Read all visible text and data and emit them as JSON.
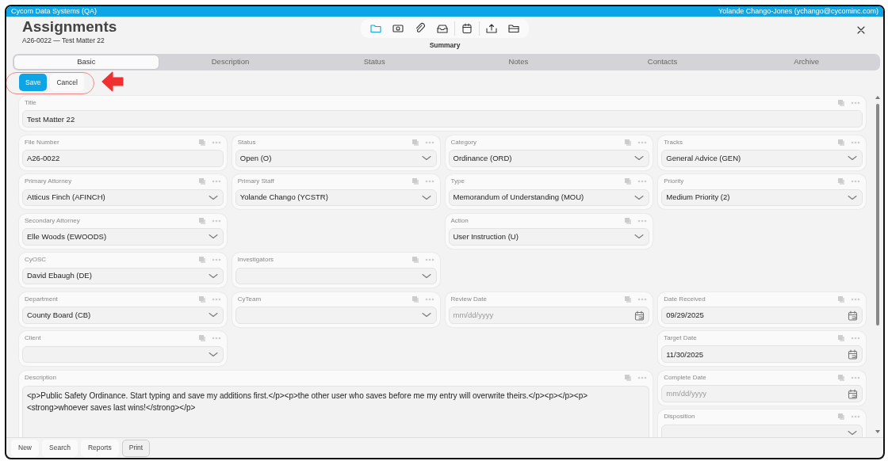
{
  "title_bar": {
    "app": "Cycom Data Systems (QA)",
    "user": "Yolande Chango-Jones (ychango@cycominc.com)"
  },
  "header": {
    "title": "Assignments",
    "subtitle": "A26-0022 — Test Matter 22",
    "view_label": "Summary"
  },
  "toolbar": [
    {
      "selected": true
    },
    {
      "selected": false
    },
    {
      "selected": false
    },
    {
      "selected": false
    },
    {
      "selected": false
    },
    {
      "selected": false
    },
    {
      "selected": false
    }
  ],
  "tabs": [
    {
      "label": "Basic",
      "selected": true
    },
    {
      "label": "Description",
      "selected": false
    },
    {
      "label": "Status",
      "selected": false
    },
    {
      "label": "Notes",
      "selected": false
    },
    {
      "label": "Contacts",
      "selected": false
    },
    {
      "label": "Archive",
      "selected": false
    }
  ],
  "actions": [
    {
      "label": "Save",
      "kind": "primary"
    },
    {
      "label": "Cancel",
      "kind": "secondary"
    }
  ],
  "fields": [
    {
      "label": "Title",
      "kind": "text",
      "value": "Test Matter 22"
    },
    {
      "label": "File Number",
      "kind": "text",
      "value": "A26-0022"
    },
    {
      "label": "Status",
      "kind": "select",
      "value": "Open (O)"
    },
    {
      "label": "Category",
      "kind": "select",
      "value": "Ordinance (ORD)"
    },
    {
      "label": "Tracks",
      "kind": "select",
      "value": "General Advice (GEN)"
    },
    {
      "label": "Primary Attorney",
      "kind": "select",
      "value": "Atticus Finch (AFINCH)"
    },
    {
      "label": "Primary Staff",
      "kind": "select",
      "value": "Yolande Chango (YCSTR)"
    },
    {
      "label": "Type",
      "kind": "select",
      "value": "Memorandum of Understanding (MOU)"
    },
    {
      "label": "Priority",
      "kind": "select",
      "value": "Medium Priority (2)"
    },
    {
      "label": "Secondary Attorney",
      "kind": "select",
      "value": "Elle Woods (EWOODS)"
    },
    {
      "label": "Action",
      "kind": "select",
      "value": "User Instruction (U)"
    },
    {
      "label": "CyOSC",
      "kind": "select",
      "value": "David Ebaugh (DE)"
    },
    {
      "label": "Investigators",
      "kind": "select"
    },
    {
      "label": "Department",
      "kind": "select",
      "value": "County Board (CB)"
    },
    {
      "label": "CyTeam",
      "kind": "select"
    },
    {
      "label": "Review Date",
      "kind": "date",
      "placeholder": "mm/dd/yyyy"
    },
    {
      "label": "Date Received",
      "kind": "date",
      "value": "09/29/2025"
    },
    {
      "label": "Client",
      "kind": "select"
    },
    {
      "label": "Target Date",
      "kind": "date",
      "value": "11/30/2025"
    },
    {
      "label": "Description",
      "kind": "textarea",
      "value": "<p>Public Safety Ordinance. Start typing and save my additions first.</p><p>the other user who saves before me my entry will overwrite theirs.</p><p></p><p><strong>whoever saves last wins!</strong></p>"
    },
    {
      "label": "Complete Date",
      "kind": "date",
      "placeholder": "mm/dd/yyyy"
    },
    {
      "label": "Disposition",
      "kind": "select"
    }
  ],
  "bottom_buttons": [
    {
      "label": "New",
      "selected": false
    },
    {
      "label": "Search",
      "selected": false
    },
    {
      "label": "Reports",
      "selected": false
    },
    {
      "label": "Print",
      "selected": true
    }
  ]
}
